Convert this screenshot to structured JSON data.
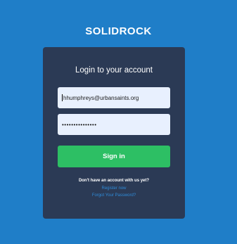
{
  "brand": {
    "name": "SOLIDROCK"
  },
  "login": {
    "title": "Login to your account",
    "email_value": "hhumphreys@urbansaints.org",
    "password_mask": "•••••••••••••••",
    "signin_label": "Sign in",
    "no_account_prompt": "Don't have an account with us yet?",
    "register_link": "Register now",
    "forgot_link": "Forgot Your Password?"
  },
  "colors": {
    "background": "#1f7ec8",
    "card": "#2b3a55",
    "input": "#e8f0fe",
    "primary_button": "#2dbf64",
    "link": "#2f8bd8"
  }
}
